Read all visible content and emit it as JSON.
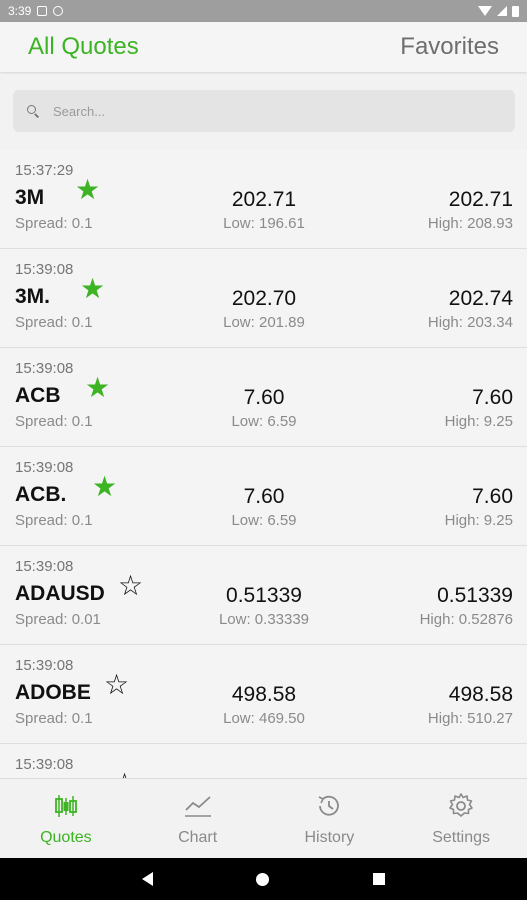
{
  "status_bar": {
    "time": "3:39"
  },
  "tabs": {
    "all_quotes": "All Quotes",
    "favorites": "Favorites"
  },
  "search": {
    "placeholder": "Search..."
  },
  "quotes": [
    {
      "time": "15:37:29",
      "symbol": "3M",
      "favorite": true,
      "spread": "Spread: 0.1",
      "bid": "202.71",
      "low": "Low: 196.61",
      "ask": "202.71",
      "high": "High: 208.93"
    },
    {
      "time": "15:39:08",
      "symbol": "3M.",
      "favorite": true,
      "spread": "Spread: 0.1",
      "bid": "202.70",
      "low": "Low: 201.89",
      "ask": "202.74",
      "high": "High: 203.34"
    },
    {
      "time": "15:39:08",
      "symbol": "ACB",
      "favorite": true,
      "spread": "Spread: 0.1",
      "bid": "7.60",
      "low": "Low: 6.59",
      "ask": "7.60",
      "high": "High: 9.25"
    },
    {
      "time": "15:39:08",
      "symbol": "ACB.",
      "favorite": true,
      "spread": "Spread: 0.1",
      "bid": "7.60",
      "low": "Low: 6.59",
      "ask": "7.60",
      "high": "High: 9.25"
    },
    {
      "time": "15:39:08",
      "symbol": "ADAUSD",
      "favorite": false,
      "spread": "Spread: 0.01",
      "bid": "0.51339",
      "low": "Low: 0.33339",
      "ask": "0.51339",
      "high": "High: 0.52876"
    },
    {
      "time": "15:39:08",
      "symbol": "ADOBE",
      "favorite": false,
      "spread": "Spread: 0.1",
      "bid": "498.58",
      "low": "Low: 469.50",
      "ask": "498.58",
      "high": "High: 510.27"
    },
    {
      "time": "15:39:08",
      "symbol": "",
      "favorite": false,
      "spread": "",
      "bid": "",
      "low": "",
      "ask": "",
      "high": ""
    }
  ],
  "bottom_nav": [
    {
      "label": "Quotes",
      "icon": "candlestick-icon",
      "active": true
    },
    {
      "label": "Chart",
      "icon": "line-chart-icon",
      "active": false
    },
    {
      "label": "History",
      "icon": "history-icon",
      "active": false
    },
    {
      "label": "Settings",
      "icon": "gear-icon",
      "active": false
    }
  ],
  "colors": {
    "accent": "#3cb424",
    "star_empty": "#111111",
    "text_muted": "#8a8a8a"
  }
}
